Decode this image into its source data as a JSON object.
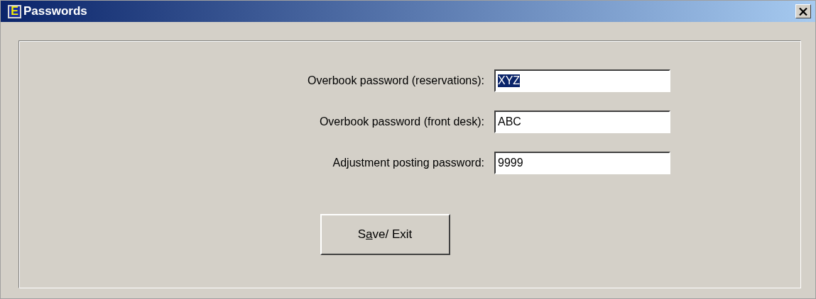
{
  "window": {
    "title": "Passwords",
    "app_icon_letter": "E"
  },
  "fields": [
    {
      "label": "Overbook password (reservations):",
      "value": "XYZ",
      "selected": true
    },
    {
      "label": "Overbook password (front desk):",
      "value": "ABC",
      "selected": false
    },
    {
      "label": "Adjustment posting password:",
      "value": "9999",
      "selected": false
    }
  ],
  "button": {
    "label_before": "S",
    "accelerator_key": "a",
    "label_after": "ve/ Exit"
  }
}
